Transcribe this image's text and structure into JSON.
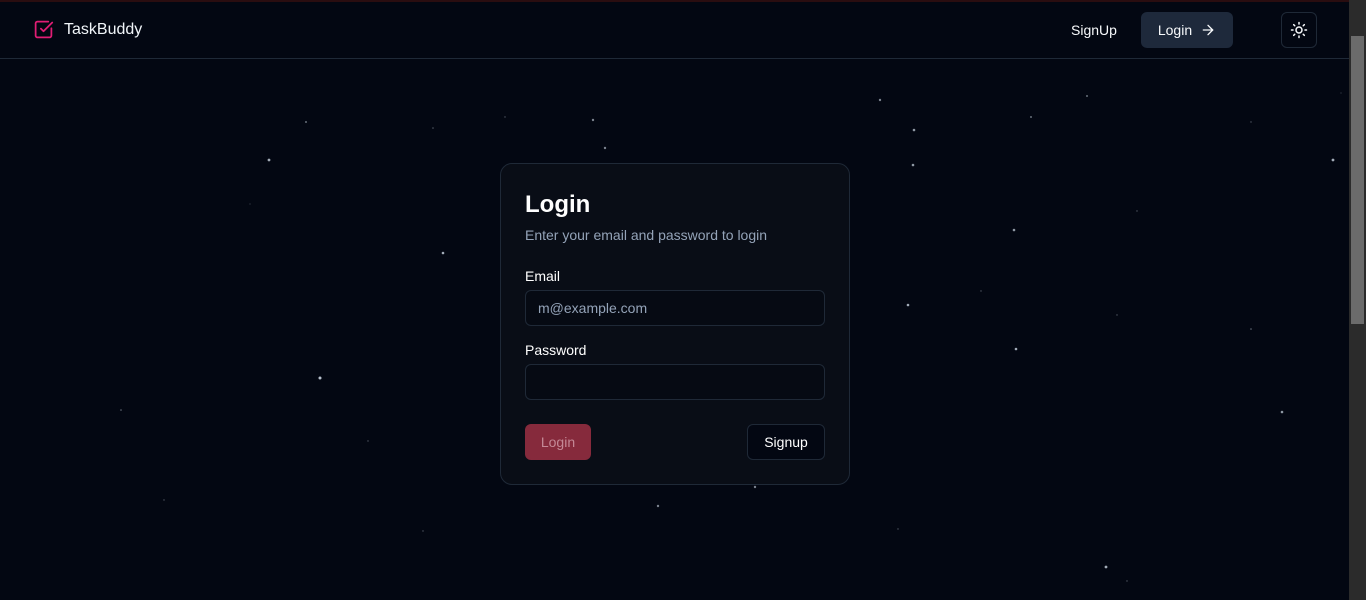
{
  "app": {
    "name": "TaskBuddy",
    "brand_color": "#e11d74"
  },
  "nav": {
    "signup_label": "SignUp",
    "login_label": "Login",
    "theme_toggle_icon": "sun-icon"
  },
  "login_card": {
    "title": "Login",
    "description": "Enter your email and password to login",
    "email_label": "Email",
    "email_placeholder": "m@example.com",
    "password_label": "Password",
    "password_value": "",
    "login_button": "Login",
    "signup_button": "Signup"
  },
  "colors": {
    "background": "#030712",
    "card": "#090d16",
    "primary_button": "#862a3c",
    "muted_text": "#94a3b8"
  }
}
